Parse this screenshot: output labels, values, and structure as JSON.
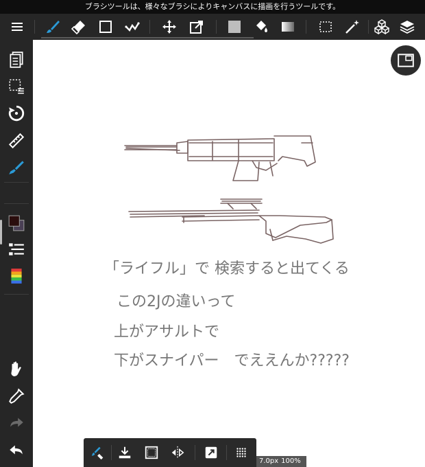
{
  "tooltip": "ブラシツールは、様々なブラシによりキャンバスに描画を行うツールです。",
  "toolbar": {
    "items": [
      "menu-icon",
      "brush-icon",
      "eraser-icon",
      "shape-icon",
      "fill-stroke-icon",
      "move-icon",
      "transform-icon",
      "fill-color-icon",
      "bucket-icon",
      "gradient-icon",
      "selection-icon",
      "magic-wand-icon",
      "materials-icon",
      "layers-icon"
    ],
    "active": "brush-icon"
  },
  "sidebar": {
    "items": [
      "pages-icon",
      "select-layer-icon",
      "rotate-icon",
      "ruler-icon",
      "pen-setting-icon",
      "color-swatch-icon",
      "brush-list-icon",
      "color-palette-icon",
      "hand-icon",
      "eyedropper-icon",
      "redo-icon",
      "undo-icon"
    ],
    "primary_color": "#2a0d0d",
    "secondary_color": "#4a3f55"
  },
  "canvas": {
    "text_lines": [
      "「ライフル」で 検索すると出てくる",
      "この2Jの違いって",
      "上がアサルトで",
      "下がスナイパー　でええんか?????"
    ],
    "stroke_color": "#7a6464"
  },
  "bottom_bar": {
    "items": [
      "brush-eraser-toggle-icon",
      "save-icon",
      "frame-icon",
      "flip-icon",
      "snap-icon",
      "grid-icon"
    ]
  },
  "status": {
    "brush_size": "7.0px",
    "zoom": "100%"
  },
  "colors": {
    "accent": "#2b9ad6",
    "toolbar_bg": "#262626"
  }
}
